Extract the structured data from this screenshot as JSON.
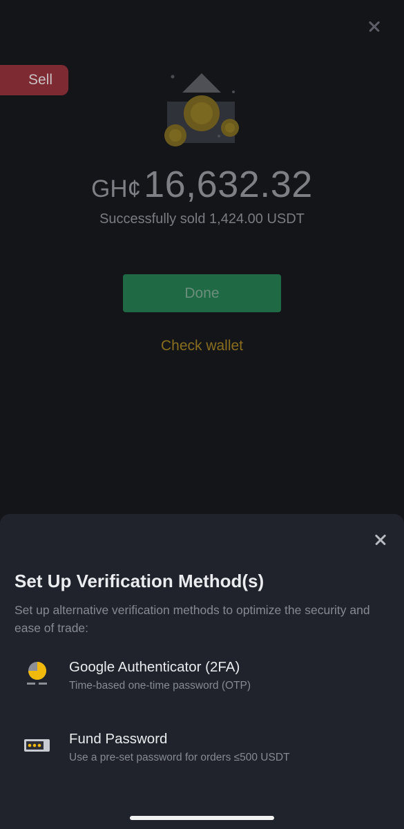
{
  "header": {
    "sell_badge": "Sell"
  },
  "result": {
    "currency": "GH¢",
    "amount": "16,632.32",
    "subtitle": "Successfully sold 1,424.00 USDT",
    "done_label": "Done",
    "check_wallet_label": "Check wallet"
  },
  "sheet": {
    "title": "Set Up Verification Method(s)",
    "description": "Set up alternative verification methods to optimize the security and ease of trade:",
    "methods": [
      {
        "title": "Google Authenticator (2FA)",
        "description": "Time-based one-time password (OTP)",
        "icon": "authenticator-icon"
      },
      {
        "title": "Fund Password",
        "description": "Use a pre-set password for orders ≤500 USDT",
        "icon": "password-icon"
      }
    ]
  },
  "colors": {
    "background": "#141519",
    "sheet": "#20232b",
    "sell": "#7e2a33",
    "done": "#1f6a45",
    "accent": "#8a6e1f"
  }
}
